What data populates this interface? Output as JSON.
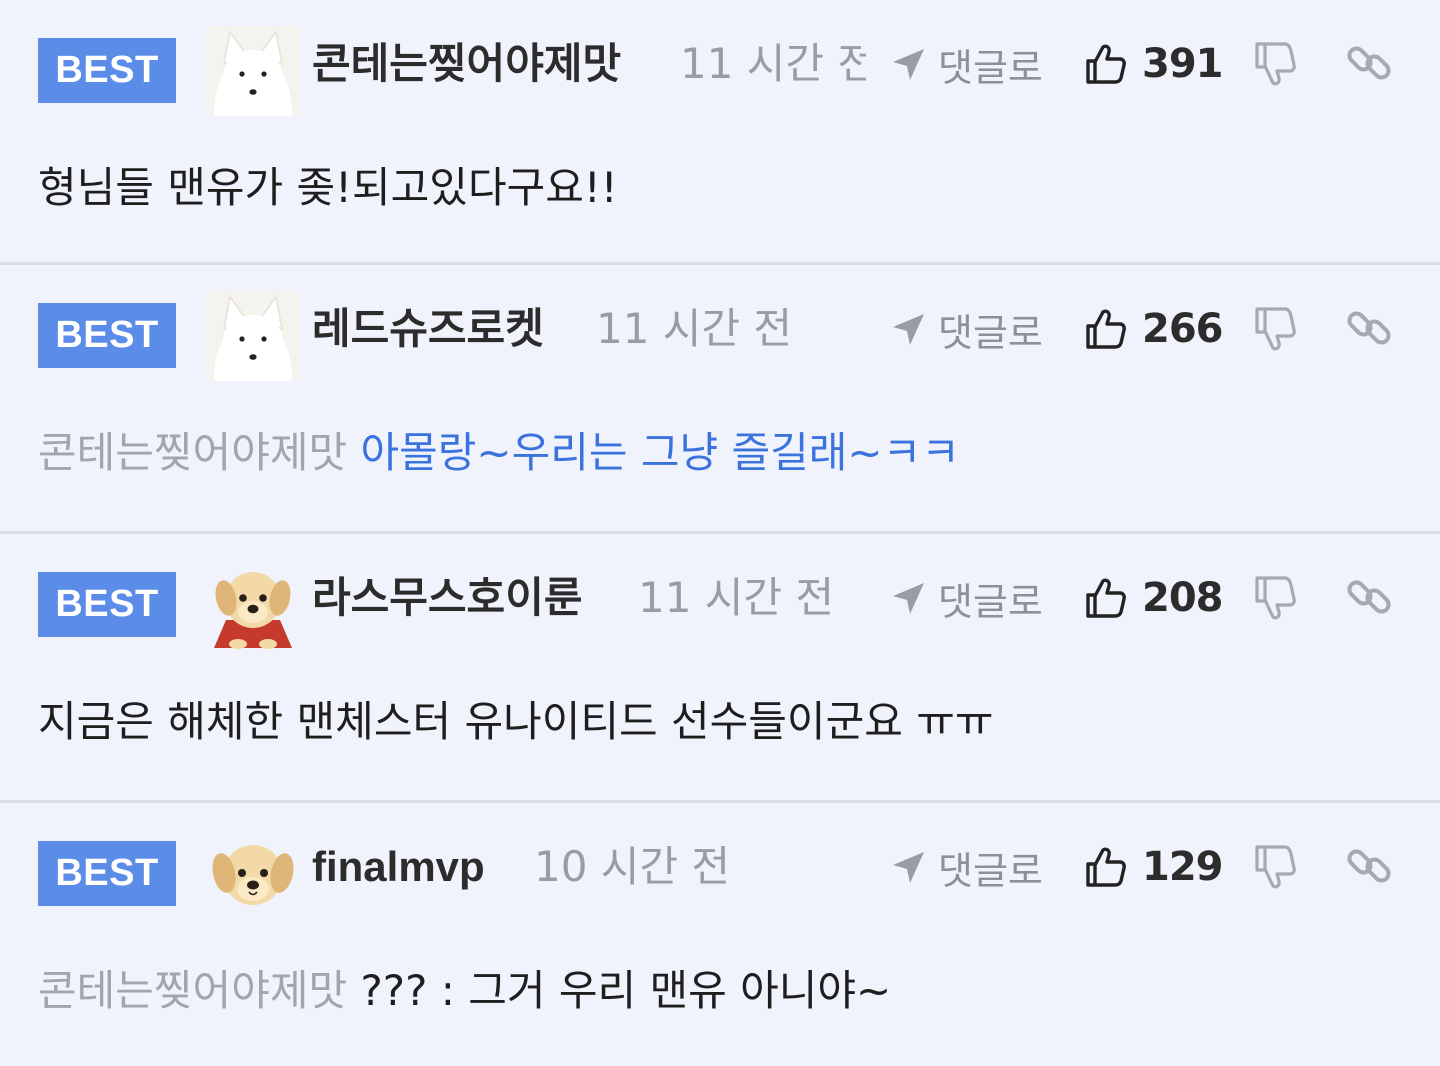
{
  "colors": {
    "background": "#f1f3fc",
    "badge": "#5b8de8",
    "mention": "#a3a5ab",
    "highlight_text": "#3a73dd"
  },
  "comments": [
    {
      "badge": "BEST",
      "avatar": "white-fox",
      "username": "콘테는찢어야제맛",
      "time": "11 시간 전",
      "reply_label": "댓글로",
      "likes": "391",
      "mention": "",
      "text": "형님들 맨유가 좆!되고있다구요!!"
    },
    {
      "badge": "BEST",
      "avatar": "white-fox",
      "username": "레드슈즈로켓",
      "time": "11 시간 전",
      "reply_label": "댓글로",
      "likes": "266",
      "mention": "콘테는찢어야제맛",
      "text": "아몰랑~우리는 그냥 즐길래~ㅋㅋ"
    },
    {
      "badge": "BEST",
      "avatar": "puppy-red-cape",
      "username": "라스무스호이룬",
      "time": "11 시간 전",
      "reply_label": "댓글로",
      "likes": "208",
      "mention": "",
      "text": "지금은 해체한 맨체스터 유나이티드 선수들이군요 ㅠㅠ"
    },
    {
      "badge": "BEST",
      "avatar": "puppy",
      "username": "finalmvp",
      "time": "10 시간 전",
      "reply_label": "댓글로",
      "likes": "129",
      "mention": "콘테는찢어야제맛",
      "text": "??? : 그거 우리 맨유 아니야~"
    }
  ]
}
